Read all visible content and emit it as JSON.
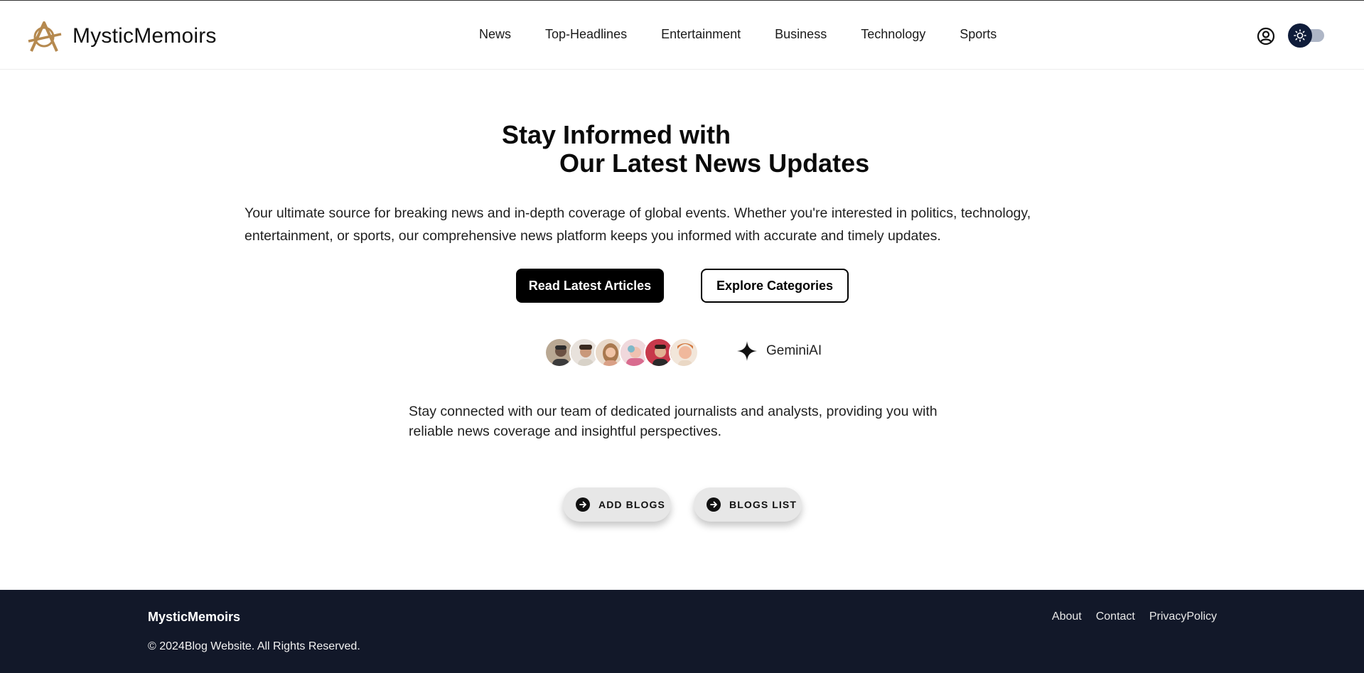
{
  "header": {
    "brand_name": "MysticMemoirs",
    "brand_color": "#b5894f",
    "nav": [
      {
        "label": "News"
      },
      {
        "label": "Top-Headlines"
      },
      {
        "label": "Entertainment"
      },
      {
        "label": "Business"
      },
      {
        "label": "Technology"
      },
      {
        "label": "Sports"
      }
    ],
    "user_icon": "user-circle-icon",
    "theme_toggle_icon": "sun-icon"
  },
  "hero": {
    "title_line1": "Stay Informed with",
    "title_line2": "Our Latest News Updates",
    "description": "Your ultimate source for breaking news and in-depth coverage of global events. Whether you're interested in politics, technology, entertainment, or sports, our comprehensive news platform keeps you informed with accurate and timely updates.",
    "primary_button": "Read Latest Articles",
    "secondary_button": "Explore Categories"
  },
  "team": {
    "avatar_count": 6,
    "ai_label": "GeminiAI",
    "ai_icon": "sparkle-icon",
    "text": "Stay connected with our team of dedicated journalists and analysts, providing you with reliable news coverage and insightful perspectives."
  },
  "actions": {
    "add_blogs": "ADD BLOGS",
    "blogs_list": "BLOGS LIST"
  },
  "footer": {
    "brand": "MysticMemoirs",
    "copyright": "© 2024Blog Website. All Rights Reserved.",
    "links": [
      {
        "label": "About"
      },
      {
        "label": "Contact"
      },
      {
        "label": "PrivacyPolicy"
      }
    ],
    "background": "#121829"
  }
}
